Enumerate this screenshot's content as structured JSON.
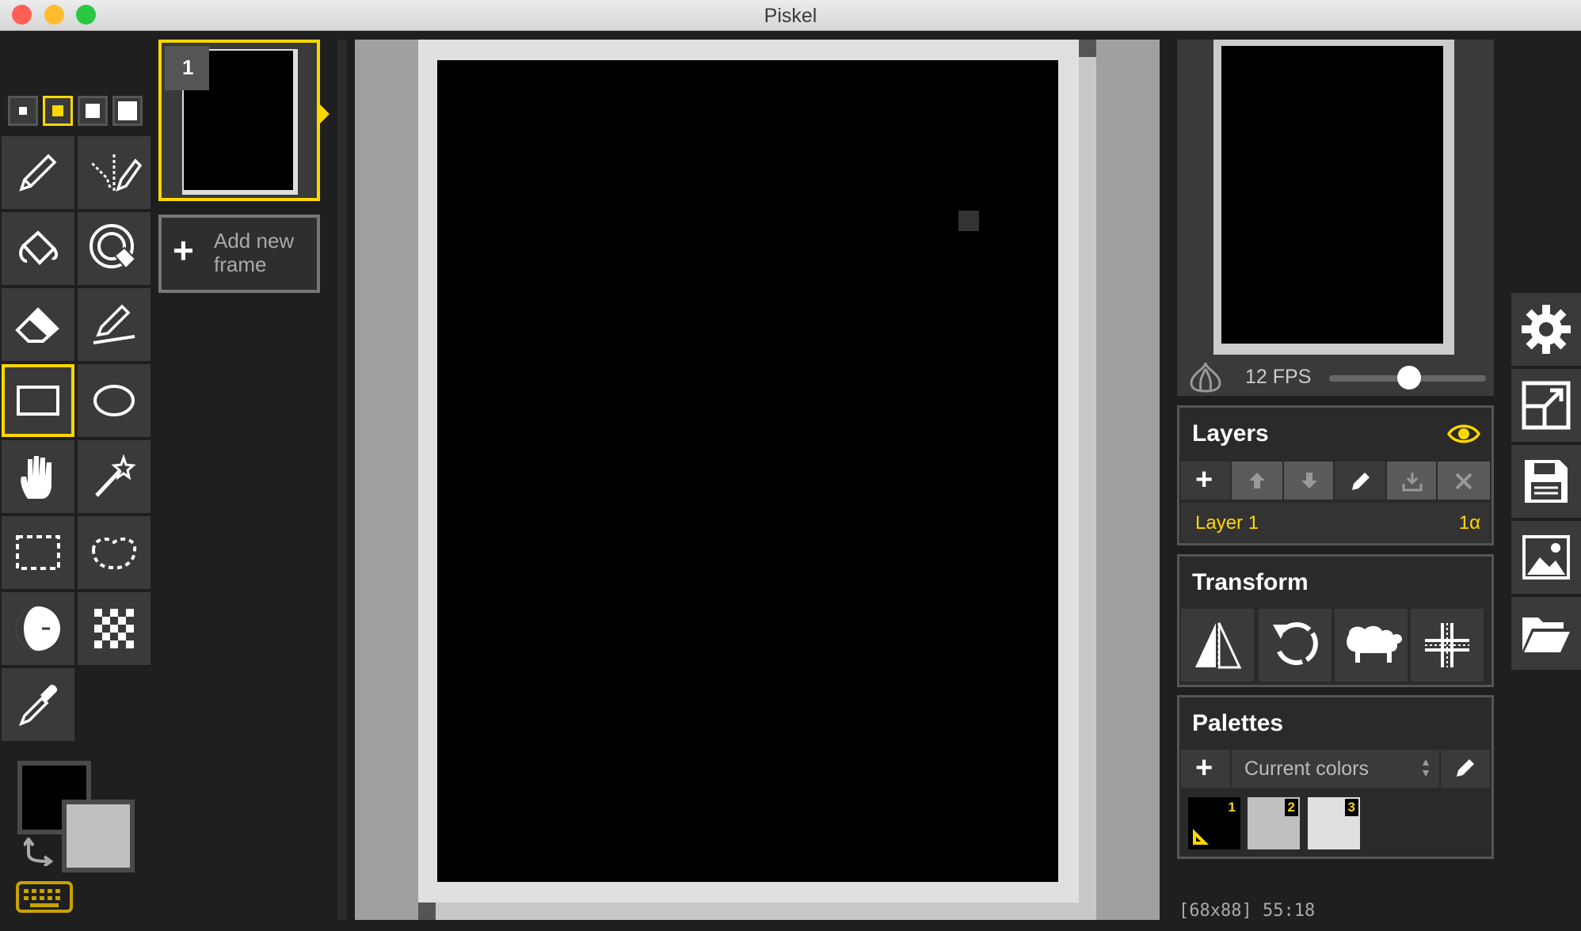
{
  "window": {
    "title": "Piskel"
  },
  "frames": {
    "first_number": "1",
    "add_label_line1": "Add new",
    "add_label_line2": "frame"
  },
  "preview": {
    "fps_label": "12 FPS",
    "fps_value": 12
  },
  "layers": {
    "title": "Layers",
    "items": [
      {
        "name": "Layer 1",
        "opacity": "1α"
      }
    ]
  },
  "transform": {
    "title": "Transform"
  },
  "palettes": {
    "title": "Palettes",
    "selected": "Current colors",
    "swatches": [
      {
        "num": "1",
        "color": "#000000"
      },
      {
        "num": "2",
        "color": "#c0c0c0"
      },
      {
        "num": "3",
        "color": "#e0e0e0"
      }
    ]
  },
  "status": {
    "text": "[68x88] 55:18"
  },
  "colors": {
    "primary": "#000000",
    "secondary": "#c0c0c0",
    "accent": "#ffd700"
  }
}
